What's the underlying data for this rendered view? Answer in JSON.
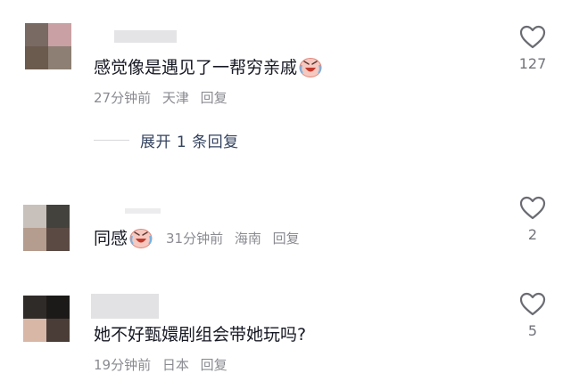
{
  "colors": {
    "text": "#161823",
    "meta": "#8a8b91",
    "expand": "#33425f",
    "background": "#ffffff"
  },
  "comments": [
    {
      "avatar_label": "blurred user avatar",
      "text": "感觉像是遇见了一帮穷亲戚",
      "emoji": "crying-laughing-emoji",
      "time": "27分钟前",
      "location": "天津",
      "reply": "回复",
      "likes": "127",
      "expand_label": "展开 1 条回复"
    },
    {
      "avatar_label": "blurred user avatar",
      "text": "同感",
      "emoji": "crying-laughing-emoji",
      "time": "31分钟前",
      "location": "海南",
      "reply": "回复",
      "likes": "2"
    },
    {
      "avatar_label": "blurred user avatar",
      "text": "她不好甄嬛剧组会带她玩吗?",
      "time": "19分钟前",
      "location": "日本",
      "reply": "回复",
      "likes": "5"
    }
  ]
}
